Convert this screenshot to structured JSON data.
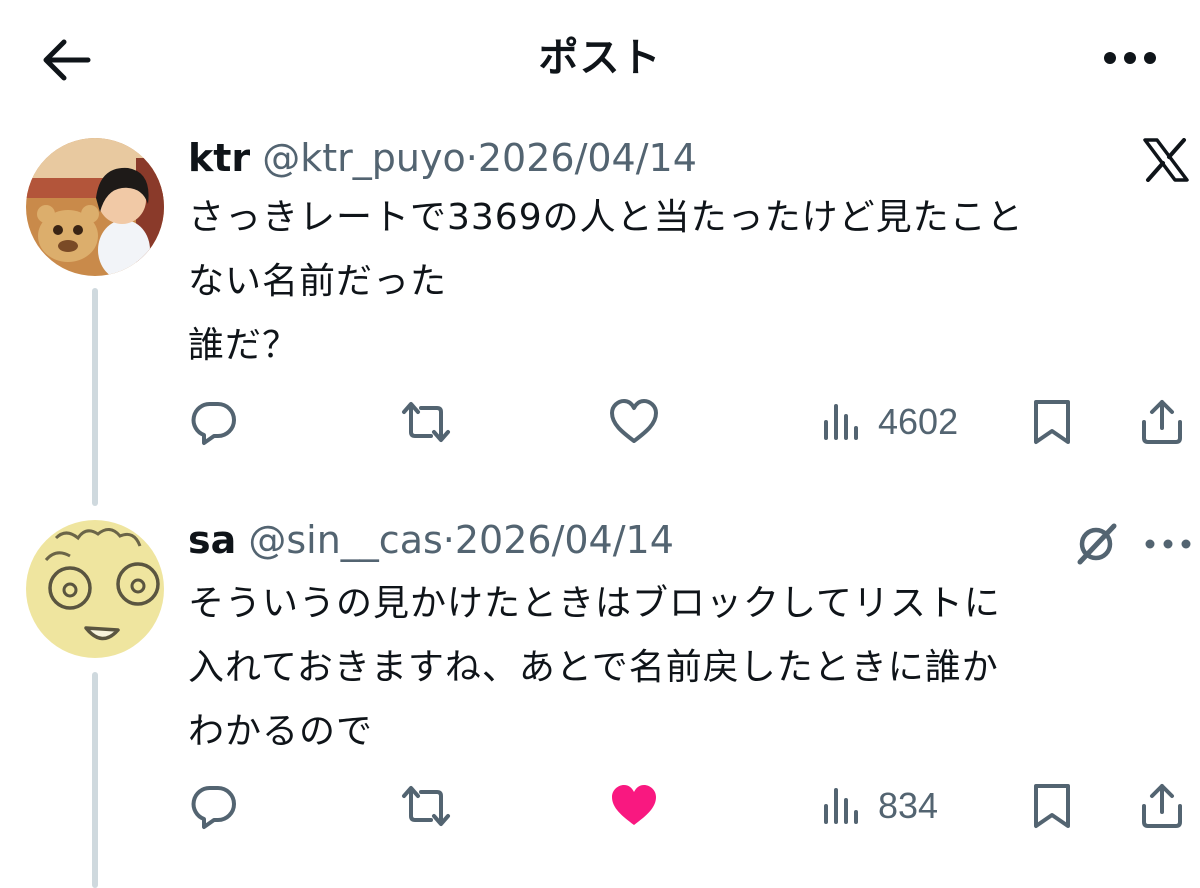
{
  "header": {
    "title": "ポスト",
    "back_icon": "arrow-left-icon",
    "more_icon": "more-dots-icon"
  },
  "posts": [
    {
      "display_name": "ktr",
      "handle": "@ktr_puyo",
      "separator": "·",
      "date": "2026/04/14",
      "badge_icon": "x-logo-icon",
      "text": "さっきレートで3369の人と当たったけど見たこと\nない名前だった\n誰だ？",
      "views": "4602",
      "liked": false
    },
    {
      "display_name": "sa",
      "handle": "@sin__cas",
      "separator": "·",
      "date": "2026/04/14",
      "badge_icon": "grok-icon",
      "text": "そういうの見かけたときはブロックしてリストに\n入れておきますね、あとで名前戻したときに誰か\nわかるので",
      "views": "834",
      "liked": true
    }
  ],
  "colors": {
    "text_primary": "#0f1419",
    "text_secondary": "#536471",
    "thread_line": "#cfd9de",
    "like_active": "#f91880"
  }
}
